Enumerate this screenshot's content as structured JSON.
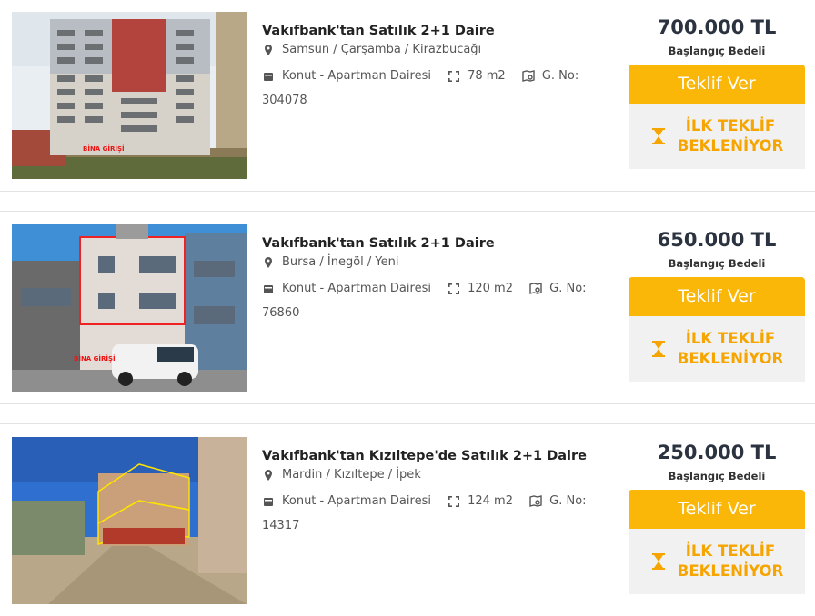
{
  "listings": [
    {
      "title": "Vakıfbank'tan Satılık 2+1 Daire",
      "location": "Samsun / Çarşamba / Kirazbucağı",
      "type": "Konut - Apartman Dairesi",
      "area": "78 m2",
      "gno_label": "G. No:",
      "gno": "304078",
      "price": "700.000 TL",
      "price_label": "Başlangıç Bedeli",
      "offer_button": "Teklif Ver",
      "status_line1": "İLK TEKLİF",
      "status_line2": "BEKLENİYOR",
      "image_label": "BİNA GİRİŞİ"
    },
    {
      "title": "Vakıfbank'tan Satılık 2+1 Daire",
      "location": "Bursa / İnegöl / Yeni",
      "type": "Konut - Apartman Dairesi",
      "area": "120 m2",
      "gno_label": "G. No:",
      "gno": "76860",
      "price": "650.000 TL",
      "price_label": "Başlangıç Bedeli",
      "offer_button": "Teklif Ver",
      "status_line1": "İLK TEKLİF",
      "status_line2": "BEKLENİYOR",
      "image_label": "BİNA GİRİŞİ"
    },
    {
      "title": "Vakıfbank'tan Kızıltepe'de Satılık 2+1 Daire",
      "location": "Mardin / Kızıltepe / İpek",
      "type": "Konut - Apartman Dairesi",
      "area": "124 m2",
      "gno_label": "G. No:",
      "gno": "14317",
      "price": "250.000 TL",
      "price_label": "Başlangıç Bedeli",
      "offer_button": "Teklif Ver",
      "status_line1": "İLK TEKLİF",
      "status_line2": "BEKLENİYOR"
    }
  ],
  "colors": {
    "accent": "#fbb708",
    "status_text": "#f6a500",
    "price_text": "#2c3340"
  },
  "icons": {
    "location": "map-pin-icon",
    "type": "building-icon",
    "area": "area-expand-icon",
    "gno": "search-map-icon",
    "status": "hourglass-icon"
  }
}
